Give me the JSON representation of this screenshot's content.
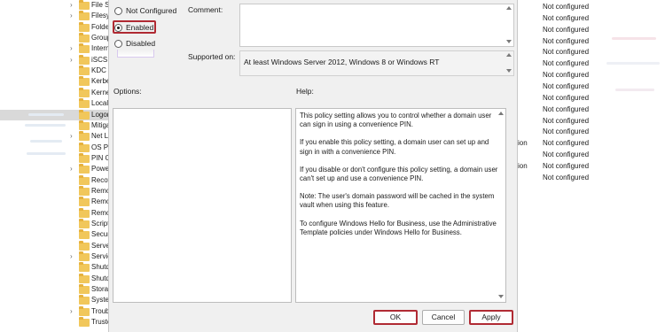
{
  "tree": {
    "items": [
      {
        "label": "File Sh",
        "chevron": true
      },
      {
        "label": "Filesy",
        "chevron": true
      },
      {
        "label": "Folde",
        "chevron": false
      },
      {
        "label": "Group",
        "chevron": false
      },
      {
        "label": "Intern",
        "chevron": true
      },
      {
        "label": "iSCSI",
        "chevron": true
      },
      {
        "label": "KDC",
        "chevron": false
      },
      {
        "label": "Kerbe",
        "chevron": false
      },
      {
        "label": "Kerne",
        "chevron": false
      },
      {
        "label": "Locali",
        "chevron": false
      },
      {
        "label": "Logon",
        "chevron": false,
        "selected": true
      },
      {
        "label": "Mitiga",
        "chevron": false
      },
      {
        "label": "Net Lo",
        "chevron": true
      },
      {
        "label": "OS Po",
        "chevron": false
      },
      {
        "label": "PIN C",
        "chevron": false
      },
      {
        "label": "Powe",
        "chevron": true
      },
      {
        "label": "Recov",
        "chevron": false
      },
      {
        "label": "Remo",
        "chevron": false
      },
      {
        "label": "Remo",
        "chevron": false
      },
      {
        "label": "Remo",
        "chevron": false
      },
      {
        "label": "Scripts",
        "chevron": false
      },
      {
        "label": "Secur",
        "chevron": false
      },
      {
        "label": "Server",
        "chevron": false
      },
      {
        "label": "Servic",
        "chevron": true
      },
      {
        "label": "Shutd",
        "chevron": false
      },
      {
        "label": "Shutd",
        "chevron": false
      },
      {
        "label": "Storag",
        "chevron": false
      },
      {
        "label": "Syster",
        "chevron": false
      },
      {
        "label": "Troub",
        "chevron": true
      },
      {
        "label": "Truste",
        "chevron": false
      }
    ]
  },
  "right_list": {
    "states": [
      "Not configured",
      "Not configured",
      "Not configured",
      "Not configured",
      "Not configured",
      "Not configured",
      "Not configured",
      "Not configured",
      "Not configured",
      "Not configured",
      "Not configured",
      "Not configured",
      "Not configured",
      "Not configured",
      "Not configured",
      "Not configured"
    ],
    "partials": [
      {
        "text": "ion",
        "row": 12
      },
      {
        "text": "ion",
        "row": 14
      }
    ]
  },
  "dialog": {
    "radios": {
      "not_configured": "Not Configured",
      "enabled": "Enabled",
      "disabled": "Disabled"
    },
    "comment_label": "Comment:",
    "supported_label": "Supported on:",
    "supported_value": "At least Windows Server 2012, Windows 8 or Windows RT",
    "options_label": "Options:",
    "help_label": "Help:",
    "help_paragraphs": [
      "This policy setting allows you to control whether a domain user can sign in using a convenience PIN.",
      "If you enable this policy setting, a domain user can set up and sign in with a convenience PIN.",
      "If you disable or don't configure this policy setting, a domain user can't set up and use a convenience PIN.",
      "Note: The user's domain password will be cached in the system vault when using this feature.",
      "To configure Windows Hello for Business, use the Administrative Template policies under Windows Hello for Business."
    ],
    "buttons": {
      "ok": "OK",
      "cancel": "Cancel",
      "apply": "Apply"
    },
    "highlight_color": "#b02a33"
  }
}
